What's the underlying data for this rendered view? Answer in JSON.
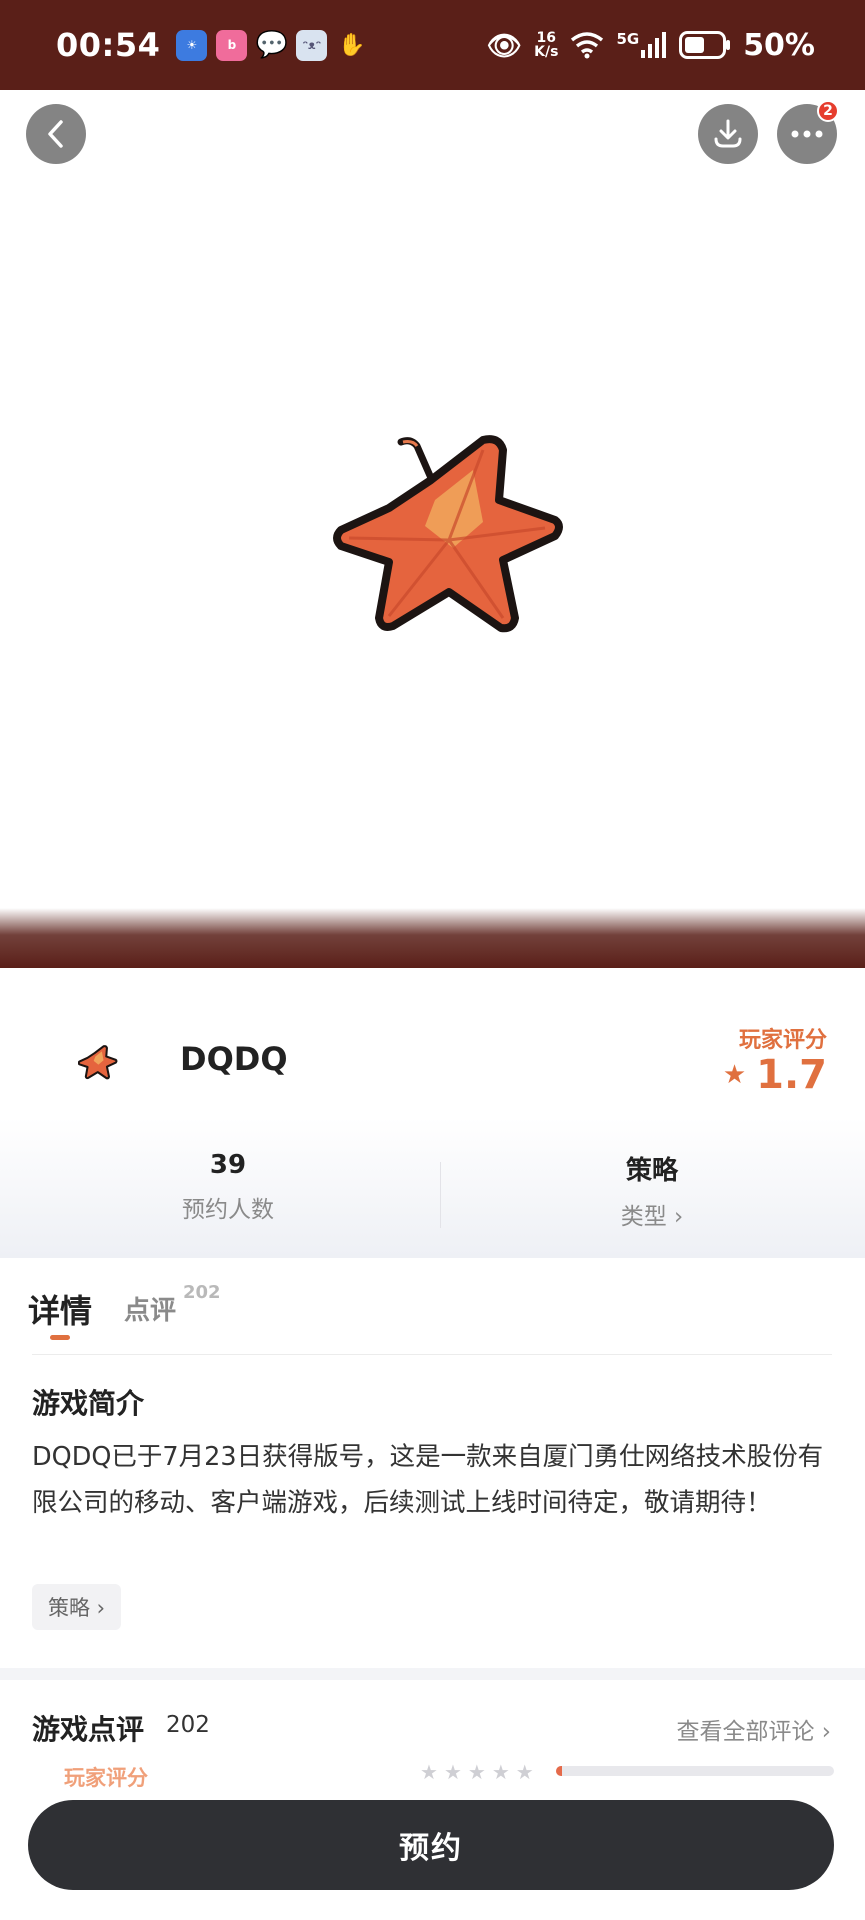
{
  "status_bar": {
    "time": "00:54",
    "net_speed_top": "16",
    "net_speed_bottom": "K/s",
    "network": "5G",
    "battery": "50%"
  },
  "header": {
    "badge_count": "2"
  },
  "game": {
    "name": "DQDQ",
    "rating_label": "玩家评分",
    "rating_value": "1.7",
    "reservations": "39",
    "reservations_label": "预约人数",
    "genre": "策略",
    "genre_label": "类型 ›"
  },
  "tabs": {
    "details": "详情",
    "reviews": "点评",
    "reviews_count": "202"
  },
  "intro": {
    "title": "游戏简介",
    "text": "DQDQ已于7月23日获得版号，这是一款来自厦门勇仕网络技术股份有限公司的移动、客户端游戏，后续测试上线时间待定，敬请期待！",
    "tag": "策略 ›"
  },
  "reviews_section": {
    "title": "游戏点评",
    "count": "202",
    "see_all": "查看全部评论 ›",
    "player_rating_label": "玩家评分",
    "five_star_share": 0.02
  },
  "cta": {
    "reserve_label": "预约"
  },
  "colors": {
    "status_bar": "#5a1f18",
    "accent": "#e0703f",
    "cta_bg": "#2f3034"
  }
}
